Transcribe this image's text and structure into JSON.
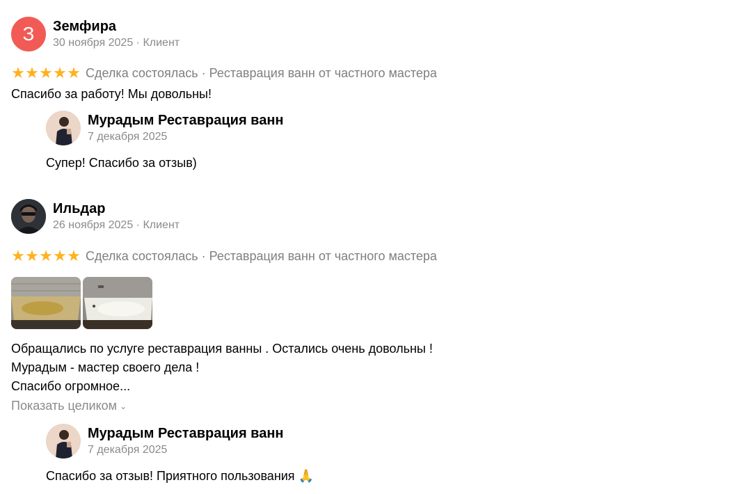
{
  "reviews": [
    {
      "avatar_letter": "З",
      "avatar_color": "#f25b55",
      "author": "Земфира",
      "meta": "30 ноября 2025 · Клиент",
      "rating": 5,
      "deal": "Сделка состоялась · Реставрация ванн от частного мастера",
      "text_lines": [
        "Спасибо за работу! Мы довольны!"
      ],
      "reply": {
        "author": "Мурадым Реставрация ванн",
        "date": "7 декабря 2025",
        "text": "Супер! Спасибо за отзыв)"
      }
    },
    {
      "author": "Ильдар",
      "meta": "26 ноября 2025 · Клиент",
      "rating": 5,
      "deal": "Сделка состоялась · Реставрация ванн от частного мастера",
      "photos": [
        "bathtub-before-photo",
        "bathtub-after-photo"
      ],
      "text_lines": [
        "Обращались по услуге реставрация ванны . Остались очень довольны !",
        "Мурадым - мастер своего дела !",
        "Спасибо огромное..."
      ],
      "show_more": "Показать целиком",
      "reply": {
        "author": "Мурадым Реставрация ванн",
        "date": "7 декабря 2025",
        "text": "Спасибо за отзыв! Приятного пользования 🙏"
      }
    }
  ],
  "colors": {
    "star": "#ffb21e",
    "muted": "#8a8a8a",
    "avatar_red": "#f25b55"
  }
}
